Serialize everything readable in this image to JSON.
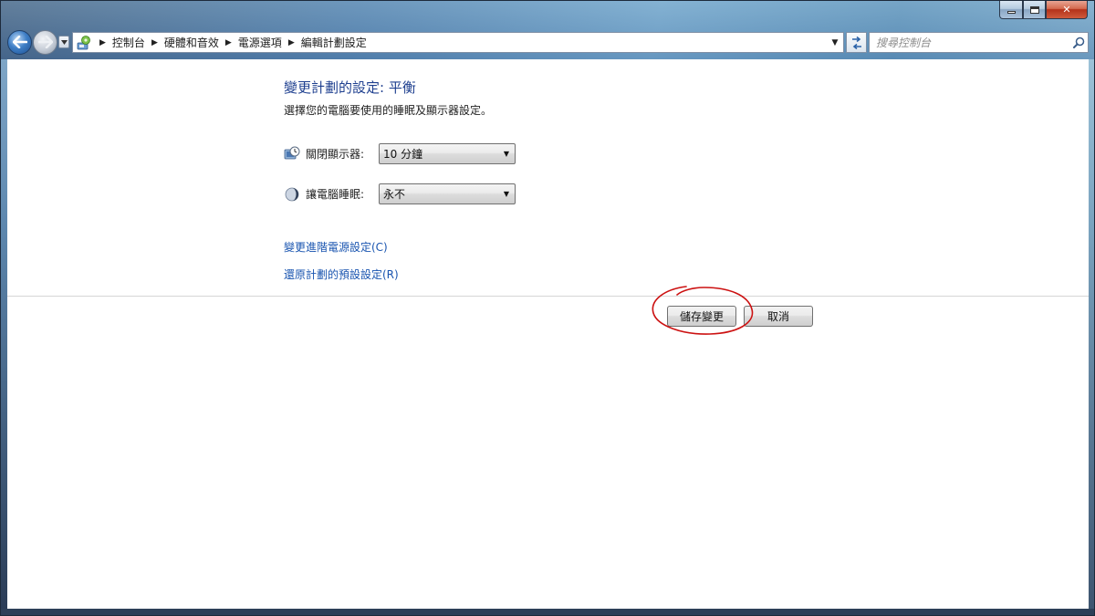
{
  "navigation": {
    "breadcrumbs": [
      "控制台",
      "硬體和音效",
      "電源選項",
      "編輯計劃設定"
    ],
    "search_placeholder": "搜尋控制台"
  },
  "content": {
    "title": "變更計劃的設定: 平衡",
    "subtitle": "選擇您的電腦要使用的睡眠及顯示器設定。",
    "settings": [
      {
        "label": "關閉顯示器:",
        "value": "10 分鐘",
        "icon": "monitor-clock-icon"
      },
      {
        "label": "讓電腦睡眠:",
        "value": "永不",
        "icon": "moon-icon"
      }
    ],
    "links": {
      "advanced": "變更進階電源設定(C)",
      "restore": "還原計劃的預設設定(R)"
    },
    "buttons": {
      "save": "儲存變更",
      "cancel": "取消"
    }
  },
  "colors": {
    "title": "#1e3f8f",
    "link": "#1a55b0",
    "annotation": "#cc1111"
  }
}
